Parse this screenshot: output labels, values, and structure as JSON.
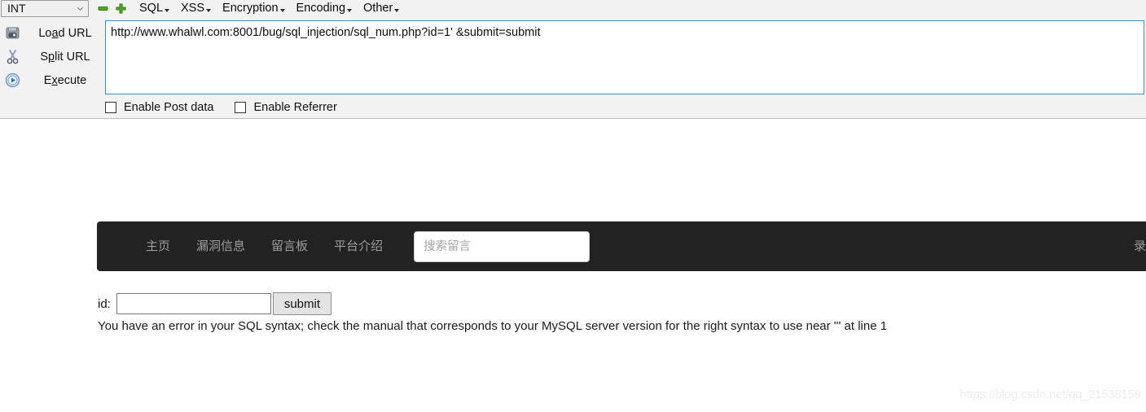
{
  "hackbar": {
    "type_select": {
      "value": "INT",
      "icon": "chevron-down-icon"
    },
    "icon_buttons": [
      {
        "name": "collapse-icon",
        "glyph": "minus",
        "color": "#4caf17"
      },
      {
        "name": "expand-icon",
        "glyph": "plus",
        "color": "#4caf17"
      }
    ],
    "menus": [
      {
        "label": "SQL",
        "caret": true
      },
      {
        "label": "XSS",
        "caret": true
      },
      {
        "label": "Encryption",
        "caret": true
      },
      {
        "label": "Encoding",
        "caret": true
      },
      {
        "label": "Other",
        "caret": true
      }
    ],
    "actions": [
      {
        "icon": "load-url-icon",
        "pre": "Lo",
        "accel": "a",
        "post": "d URL"
      },
      {
        "icon": "scissors-icon",
        "pre": "S",
        "accel": "p",
        "post": "lit URL"
      },
      {
        "icon": "execute-play-icon",
        "pre": "E",
        "accel": "x",
        "post": "ecute"
      }
    ],
    "url_value": "http://www.whalwl.com:8001/bug/sql_injection/sql_num.php?id=1' &submit=submit",
    "url_placeholder": "",
    "checkboxes": [
      {
        "label": "Enable Post data",
        "checked": false
      },
      {
        "label": "Enable Referrer",
        "checked": false
      }
    ]
  },
  "page": {
    "nav": {
      "links": [
        "主页",
        "漏洞信息",
        "留言板",
        "平台介绍"
      ],
      "search_placeholder": "搜索留言",
      "search_value": "",
      "right_label": "登录"
    },
    "form": {
      "id_label": "id:",
      "id_value": "",
      "id_placeholder": "",
      "submit_label": "submit"
    },
    "error_message": "You have an error in your SQL syntax; check the manual that corresponds to your MySQL server version for the right syntax to use near ''' at line 1",
    "watermark": "https://blog.csdn.net/qq_21538159"
  },
  "colors": {
    "toolbar_bg": "#f2f2f2",
    "navbar_bg": "#222222",
    "focus_border": "#3f8fd2",
    "accent_green": "#4caf17"
  }
}
